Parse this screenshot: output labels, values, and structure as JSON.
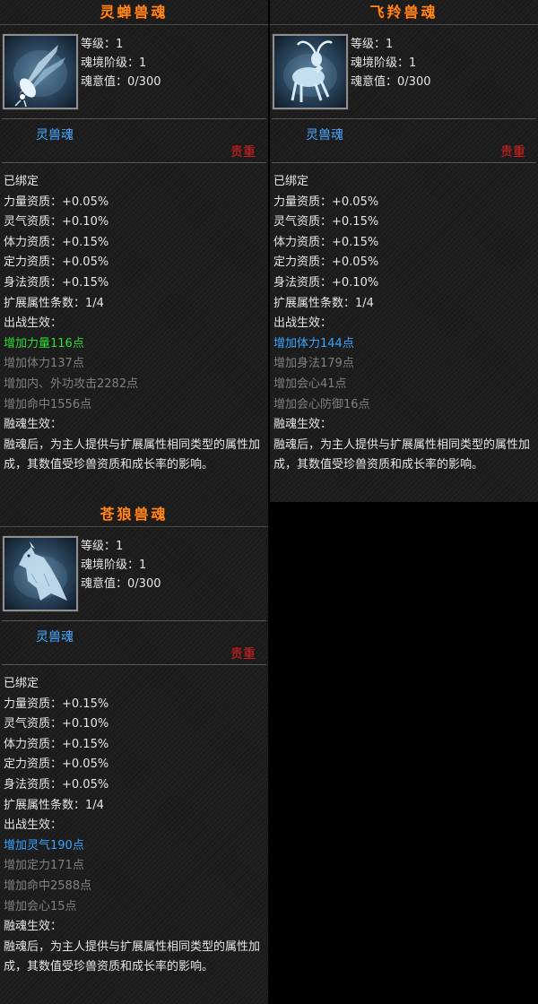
{
  "labels": {
    "level": "等级：",
    "stage": "魂境阶级：",
    "will": "魂意值：",
    "bound": "已绑定",
    "power": "力量资质：",
    "spirit": "灵气资质：",
    "stamina": "体力资质：",
    "focus": "定力资质：",
    "agility": "身法资质：",
    "ext": "扩展属性条数：",
    "battle": "出战生效：",
    "fusion": "融魂生效：",
    "fusion_desc": "融魂后，为主人提供与扩展属性相同类型的属性加成，其数值受珍兽资质和成长率的影响。"
  },
  "cards": [
    {
      "name": "灵蝉兽魂",
      "icon": "cicada-icon",
      "level": "1",
      "stage": "1",
      "will": "0/300",
      "type": "灵兽魂",
      "rarity": "贵重",
      "power": "+0.05%",
      "spirit": "+0.10%",
      "stamina": "+0.15%",
      "focus": "+0.05%",
      "agility": "+0.15%",
      "ext": "1/4",
      "active_effect": "增加力量116点",
      "active_color": "#2fdc37",
      "inactive_effects": [
        "增加体力137点",
        "增加内、外功攻击2282点",
        "增加命中1556点"
      ]
    },
    {
      "name": "飞羚兽魂",
      "icon": "antelope-icon",
      "level": "1",
      "stage": "1",
      "will": "0/300",
      "type": "灵兽魂",
      "rarity": "贵重",
      "power": "+0.05%",
      "spirit": "+0.15%",
      "stamina": "+0.15%",
      "focus": "+0.05%",
      "agility": "+0.10%",
      "ext": "1/4",
      "active_effect": "增加体力144点",
      "active_color": "#3aa4ff",
      "inactive_effects": [
        "增加身法179点",
        "增加会心41点",
        "增加会心防御16点"
      ]
    },
    {
      "name": "苍狼兽魂",
      "icon": "wolf-icon",
      "level": "1",
      "stage": "1",
      "will": "0/300",
      "type": "灵兽魂",
      "rarity": "贵重",
      "power": "+0.15%",
      "spirit": "+0.10%",
      "stamina": "+0.15%",
      "focus": "+0.05%",
      "agility": "+0.05%",
      "ext": "1/4",
      "active_effect": "增加灵气190点",
      "active_color": "#3aa4ff",
      "inactive_effects": [
        "增加定力171点",
        "增加命中2588点",
        "增加会心15点"
      ]
    }
  ]
}
